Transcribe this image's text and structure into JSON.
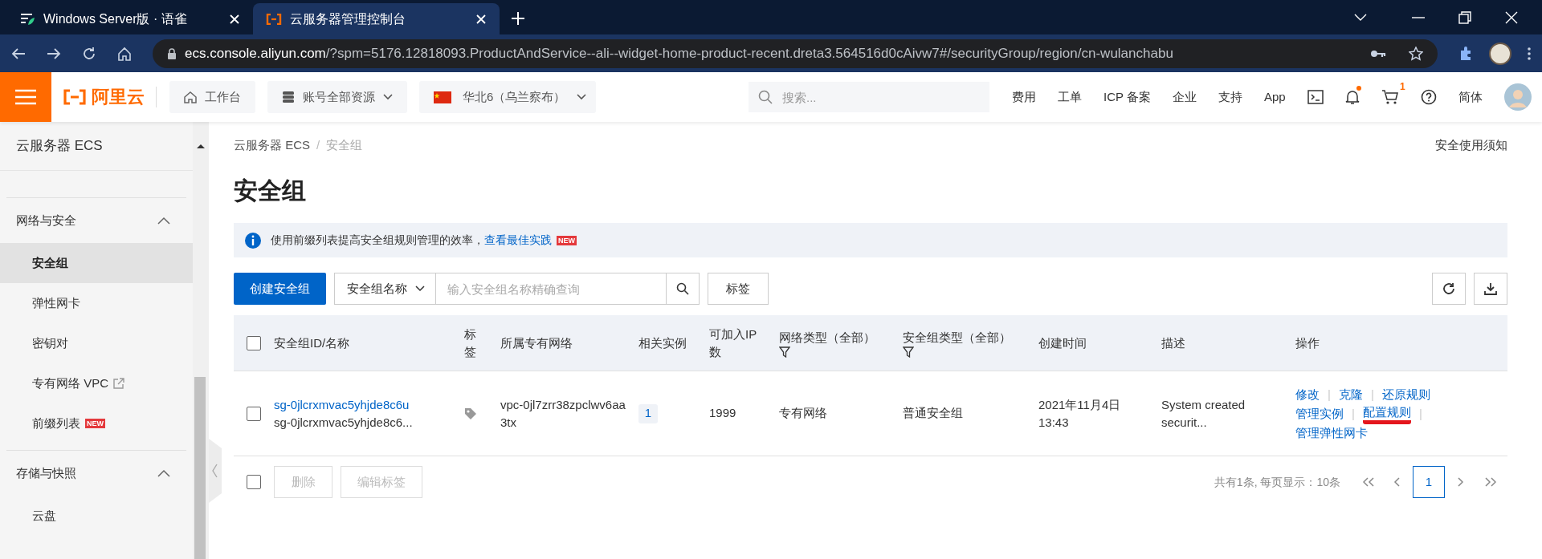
{
  "browser": {
    "tabs": [
      {
        "title": "Windows Server版 · 语雀",
        "selected": false
      },
      {
        "title": "云服务器管理控制台",
        "selected": true
      }
    ],
    "url_host": "ecs.console.aliyun.com",
    "url_rest": "/?spm=5176.12818093.ProductAndService--ali--widget-home-product-recent.dreta3.564516d0cAivw7#/securityGroup/region/cn-wulanchabu"
  },
  "header": {
    "logo": "阿里云",
    "workbench": "工作台",
    "resources": "账号全部资源",
    "region": "华北6（乌兰察布）",
    "search_placeholder": "搜索...",
    "links": [
      "费用",
      "工单",
      "ICP 备案",
      "企业",
      "支持",
      "App"
    ],
    "notification": true,
    "cart_badge": "1",
    "language": "简体"
  },
  "sidebar": {
    "title": "云服务器 ECS",
    "groups": [
      {
        "label": "网络与安全",
        "expanded": true,
        "items": [
          {
            "label": "安全组",
            "selected": true
          },
          {
            "label": "弹性网卡",
            "selected": false
          },
          {
            "label": "密钥对",
            "selected": false
          },
          {
            "label": "专有网络 VPC",
            "selected": false,
            "external": true
          },
          {
            "label": "前缀列表",
            "selected": false,
            "badge": "NEW"
          }
        ]
      },
      {
        "label": "存储与快照",
        "expanded": true,
        "items": [
          {
            "label": "云盘",
            "selected": false
          }
        ]
      }
    ]
  },
  "page": {
    "breadcrumb": [
      "云服务器 ECS",
      "安全组"
    ],
    "breadcrumb_separator": "/",
    "title": "安全组",
    "help_link": "安全使用须知",
    "notice": {
      "text": "使用前缀列表提高安全组规则管理的效率，",
      "link": "查看最佳实践",
      "badge": "NEW"
    },
    "toolbar": {
      "create": "创建安全组",
      "filter_field": "安全组名称",
      "search_placeholder": "输入安全组名称精确查询",
      "tag_button": "标签"
    },
    "table": {
      "select_all_checked": false,
      "columns": [
        {
          "label": "安全组ID/名称",
          "filter": false
        },
        {
          "label": "标签",
          "filter": false
        },
        {
          "label": "所属专有网络",
          "filter": false
        },
        {
          "label": "相关实例",
          "filter": false
        },
        {
          "label": "可加入IP数",
          "filter": false
        },
        {
          "label": "网络类型（全部）",
          "filter": true
        },
        {
          "label": "安全组类型（全部）",
          "filter": true
        },
        {
          "label": "创建时间",
          "filter": false
        },
        {
          "label": "描述",
          "filter": false
        },
        {
          "label": "操作",
          "filter": false
        }
      ],
      "rows": [
        {
          "checked": false,
          "id": "sg-0jlcrxmvac5yhjde8c6u",
          "name": "sg-0jlcrxmvac5yhjde8c6...",
          "vpc": "vpc-0jl7zrr38zpclwv6aa3tx",
          "instances": "1",
          "ip_count": "1999",
          "network_type": "专有网络",
          "sg_type": "普通安全组",
          "created_date": "2021年11月4日",
          "created_time": "13:43",
          "description": "System created securit...",
          "actions": [
            [
              {
                "label": "修改",
                "highlighted": false,
                "separator": "|"
              },
              {
                "label": "克隆",
                "highlighted": false,
                "separator": "|"
              },
              {
                "label": "还原规则",
                "highlighted": false
              }
            ],
            [
              {
                "label": "管理实例",
                "highlighted": false,
                "separator": "|"
              },
              {
                "label": "配置规则",
                "highlighted": true,
                "separator": "|"
              }
            ],
            [
              {
                "label": "管理弹性网卡",
                "highlighted": false
              }
            ]
          ]
        }
      ]
    },
    "footer": {
      "select_all_checked": false,
      "buttons": [
        "删除",
        "编辑标签"
      ],
      "summary": "共有1条, 每页显示：10条",
      "pages": [
        {
          "label": "1",
          "selected": true
        }
      ]
    }
  }
}
